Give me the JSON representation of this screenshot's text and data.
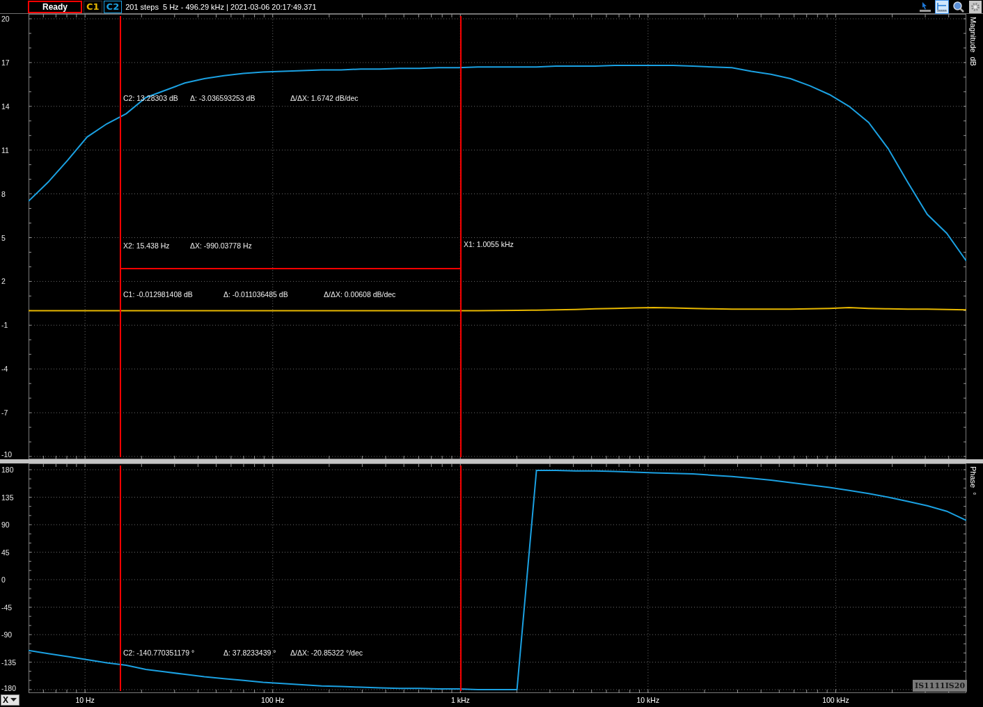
{
  "toolbar": {
    "status": "Ready",
    "channels": [
      {
        "label": "C1",
        "color": "#e8b800",
        "selected": false
      },
      {
        "label": "C2",
        "color": "#1ba1e2",
        "selected": true
      }
    ],
    "info": "201 steps  5 Hz - 496.29 kHz | 2021-03-06 20:17:49.371",
    "tools": [
      {
        "kind": "pointer",
        "selected": false
      },
      {
        "kind": "ruler",
        "selected": true
      },
      {
        "kind": "zoom",
        "selected": false
      },
      {
        "kind": "settings",
        "selected": false
      }
    ]
  },
  "magnitude": {
    "chart_data": {
      "type": "line",
      "ylabel": "Magnitude  dB",
      "grid": true,
      "ylim": [
        -10,
        20
      ],
      "yticks": [
        {
          "value": 20,
          "label": "20"
        },
        {
          "value": 17,
          "label": "17"
        },
        {
          "value": 14,
          "label": "14"
        },
        {
          "value": 11,
          "label": "11"
        },
        {
          "value": 8,
          "label": "8"
        },
        {
          "value": 5,
          "label": "5"
        },
        {
          "value": 2,
          "label": "2"
        },
        {
          "value": -1,
          "label": "-1"
        },
        {
          "value": -4,
          "label": "-4"
        },
        {
          "value": -7,
          "label": "-7"
        },
        {
          "value": -10,
          "label": "-10"
        }
      ],
      "series": [
        {
          "color": "#e8b800",
          "values": [
            -0.01,
            -0.01,
            -0.01,
            -0.01,
            -0.01,
            -0.01,
            -0.01,
            -0.01,
            -0.01,
            -0.01,
            -0.01,
            -0.01,
            -0.01,
            -0.01,
            -0.01,
            -0.01,
            -0.01,
            -0.01,
            -0.01,
            -0.01,
            -0.01,
            -0.01,
            -0.01,
            -0.01,
            0,
            0.01,
            0.03,
            0.05,
            0.08,
            0.12,
            0.15,
            0.18,
            0.2,
            0.18,
            0.15,
            0.12,
            0.1,
            0.1,
            0.1,
            0.1,
            0.12,
            0.15,
            0.2,
            0.15,
            0.12,
            0.1,
            0.1,
            0.08,
            0.05
          ]
        },
        {
          "color": "#1ba1e2",
          "values": [
            7.5,
            8.8,
            10.3,
            11.9,
            12.8,
            13.5,
            14.6,
            15.1,
            15.6,
            15.9,
            16.1,
            16.25,
            16.35,
            16.4,
            16.45,
            16.5,
            16.5,
            16.55,
            16.55,
            16.6,
            16.6,
            16.65,
            16.65,
            16.7,
            16.7,
            16.7,
            16.7,
            16.75,
            16.75,
            16.75,
            16.8,
            16.8,
            16.8,
            16.8,
            16.75,
            16.7,
            16.65,
            16.4,
            16.2,
            15.9,
            15.4,
            14.8,
            14.0,
            12.9,
            11.1,
            8.8,
            6.6,
            5.3,
            3.4
          ]
        }
      ]
    },
    "readouts": [
      {
        "kind": "c2",
        "texts": [
          "C2: 13.28303 dB",
          "Δ: -3.036593253 dB",
          "Δ/ΔX: 1.6742 dB/dec"
        ]
      },
      {
        "kind": "x2",
        "texts": [
          "X2: 15.438 Hz",
          "ΔX: -990.03778 Hz"
        ]
      },
      {
        "kind": "x1",
        "texts": [
          "X1: 1.0055 kHz"
        ]
      },
      {
        "kind": "c1",
        "texts": [
          "C1: -0.012981408 dB",
          "Δ: -0.011036485 dB",
          "Δ/ΔX: 0.00608 dB/dec"
        ]
      }
    ]
  },
  "phase": {
    "chart_data": {
      "type": "line",
      "ylabel": "Phase  °",
      "grid": true,
      "ylim": [
        -180,
        180
      ],
      "yticks": [
        {
          "value": 180,
          "label": "180"
        },
        {
          "value": 135,
          "label": "135"
        },
        {
          "value": 90,
          "label": "90"
        },
        {
          "value": 45,
          "label": "45"
        },
        {
          "value": 0,
          "label": "0"
        },
        {
          "value": -45,
          "label": "-45"
        },
        {
          "value": -90,
          "label": "-90"
        },
        {
          "value": -135,
          "label": "-135"
        },
        {
          "value": -180,
          "label": "-180"
        }
      ],
      "series": [
        {
          "color": "#1ba1e2",
          "values": [
            -116,
            -121,
            -126,
            -131,
            -136,
            -140,
            -147,
            -151,
            -155,
            -159,
            -162,
            -165,
            -168,
            -170,
            -172,
            -174,
            -175,
            -176,
            -177,
            -178,
            -178,
            -179,
            -179,
            -180,
            -180,
            -180,
            179,
            179,
            178,
            178,
            177,
            176,
            175,
            174,
            173,
            171,
            169,
            166,
            163,
            159,
            155,
            151,
            146,
            141,
            135,
            128,
            121,
            112,
            97
          ]
        }
      ]
    },
    "readouts": [
      {
        "kind": "c2",
        "texts": [
          "C2: -140.770351179 °",
          "Δ: 37.8233439 °",
          "Δ/ΔX: -20.85322 °/dec"
        ]
      }
    ],
    "device_label": "IS1111IS20"
  },
  "x_axis": {
    "selector": "X",
    "labels": [
      "10 Hz",
      "100 Hz",
      "1 kHz",
      "10 kHz",
      "100 kHz"
    ]
  }
}
